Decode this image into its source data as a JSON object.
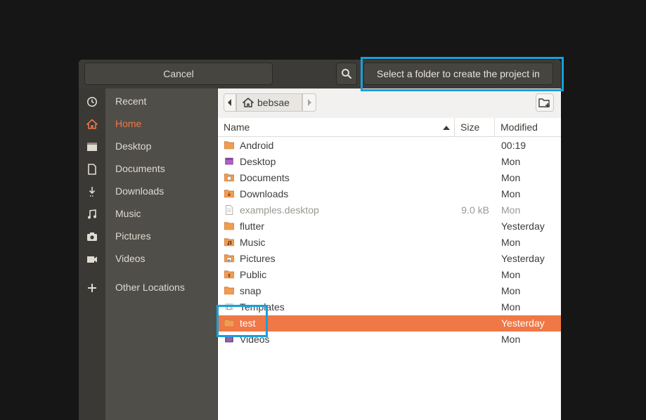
{
  "header": {
    "cancel_label": "Cancel",
    "search_icon": "search-icon",
    "select_label": "Select a folder to create the project in"
  },
  "sidebar": {
    "items": [
      {
        "label": "Recent",
        "icon": "clock-icon",
        "active": false
      },
      {
        "label": "Home",
        "icon": "home-icon",
        "active": true
      },
      {
        "label": "Desktop",
        "icon": "desktop-icon",
        "active": false
      },
      {
        "label": "Documents",
        "icon": "document-icon",
        "active": false
      },
      {
        "label": "Downloads",
        "icon": "download-icon",
        "active": false
      },
      {
        "label": "Music",
        "icon": "music-icon",
        "active": false
      },
      {
        "label": "Pictures",
        "icon": "camera-icon",
        "active": false
      },
      {
        "label": "Videos",
        "icon": "video-icon",
        "active": false
      },
      {
        "label": "Other Locations",
        "icon": "plus-icon",
        "active": false
      }
    ]
  },
  "pathbar": {
    "current": "bebsae"
  },
  "columns": {
    "name": "Name",
    "size": "Size",
    "modified": "Modified"
  },
  "files": [
    {
      "name": "Android",
      "size": "",
      "modified": "00:19",
      "type": "folder"
    },
    {
      "name": "Desktop",
      "size": "",
      "modified": "Mon",
      "type": "desktop-folder"
    },
    {
      "name": "Documents",
      "size": "",
      "modified": "Mon",
      "type": "documents-folder"
    },
    {
      "name": "Downloads",
      "size": "",
      "modified": "Mon",
      "type": "downloads-folder"
    },
    {
      "name": "examples.desktop",
      "size": "9.0 kB",
      "modified": "Mon",
      "type": "file"
    },
    {
      "name": "flutter",
      "size": "",
      "modified": "Yesterday",
      "type": "folder"
    },
    {
      "name": "Music",
      "size": "",
      "modified": "Mon",
      "type": "music-folder"
    },
    {
      "name": "Pictures",
      "size": "",
      "modified": "Yesterday",
      "type": "pictures-folder"
    },
    {
      "name": "Public",
      "size": "",
      "modified": "Mon",
      "type": "public-folder"
    },
    {
      "name": "snap",
      "size": "",
      "modified": "Mon",
      "type": "folder"
    },
    {
      "name": "Templates",
      "size": "",
      "modified": "Mon",
      "type": "templates-folder"
    },
    {
      "name": "test",
      "size": "",
      "modified": "Yesterday",
      "type": "folder",
      "selected": true
    },
    {
      "name": "Videos",
      "size": "",
      "modified": "Mon",
      "type": "videos-folder"
    }
  ],
  "colors": {
    "accent": "#f07746",
    "headerbar": "#3c3b37",
    "sidebar": "#504e48",
    "highlight": "#17a0dc"
  }
}
